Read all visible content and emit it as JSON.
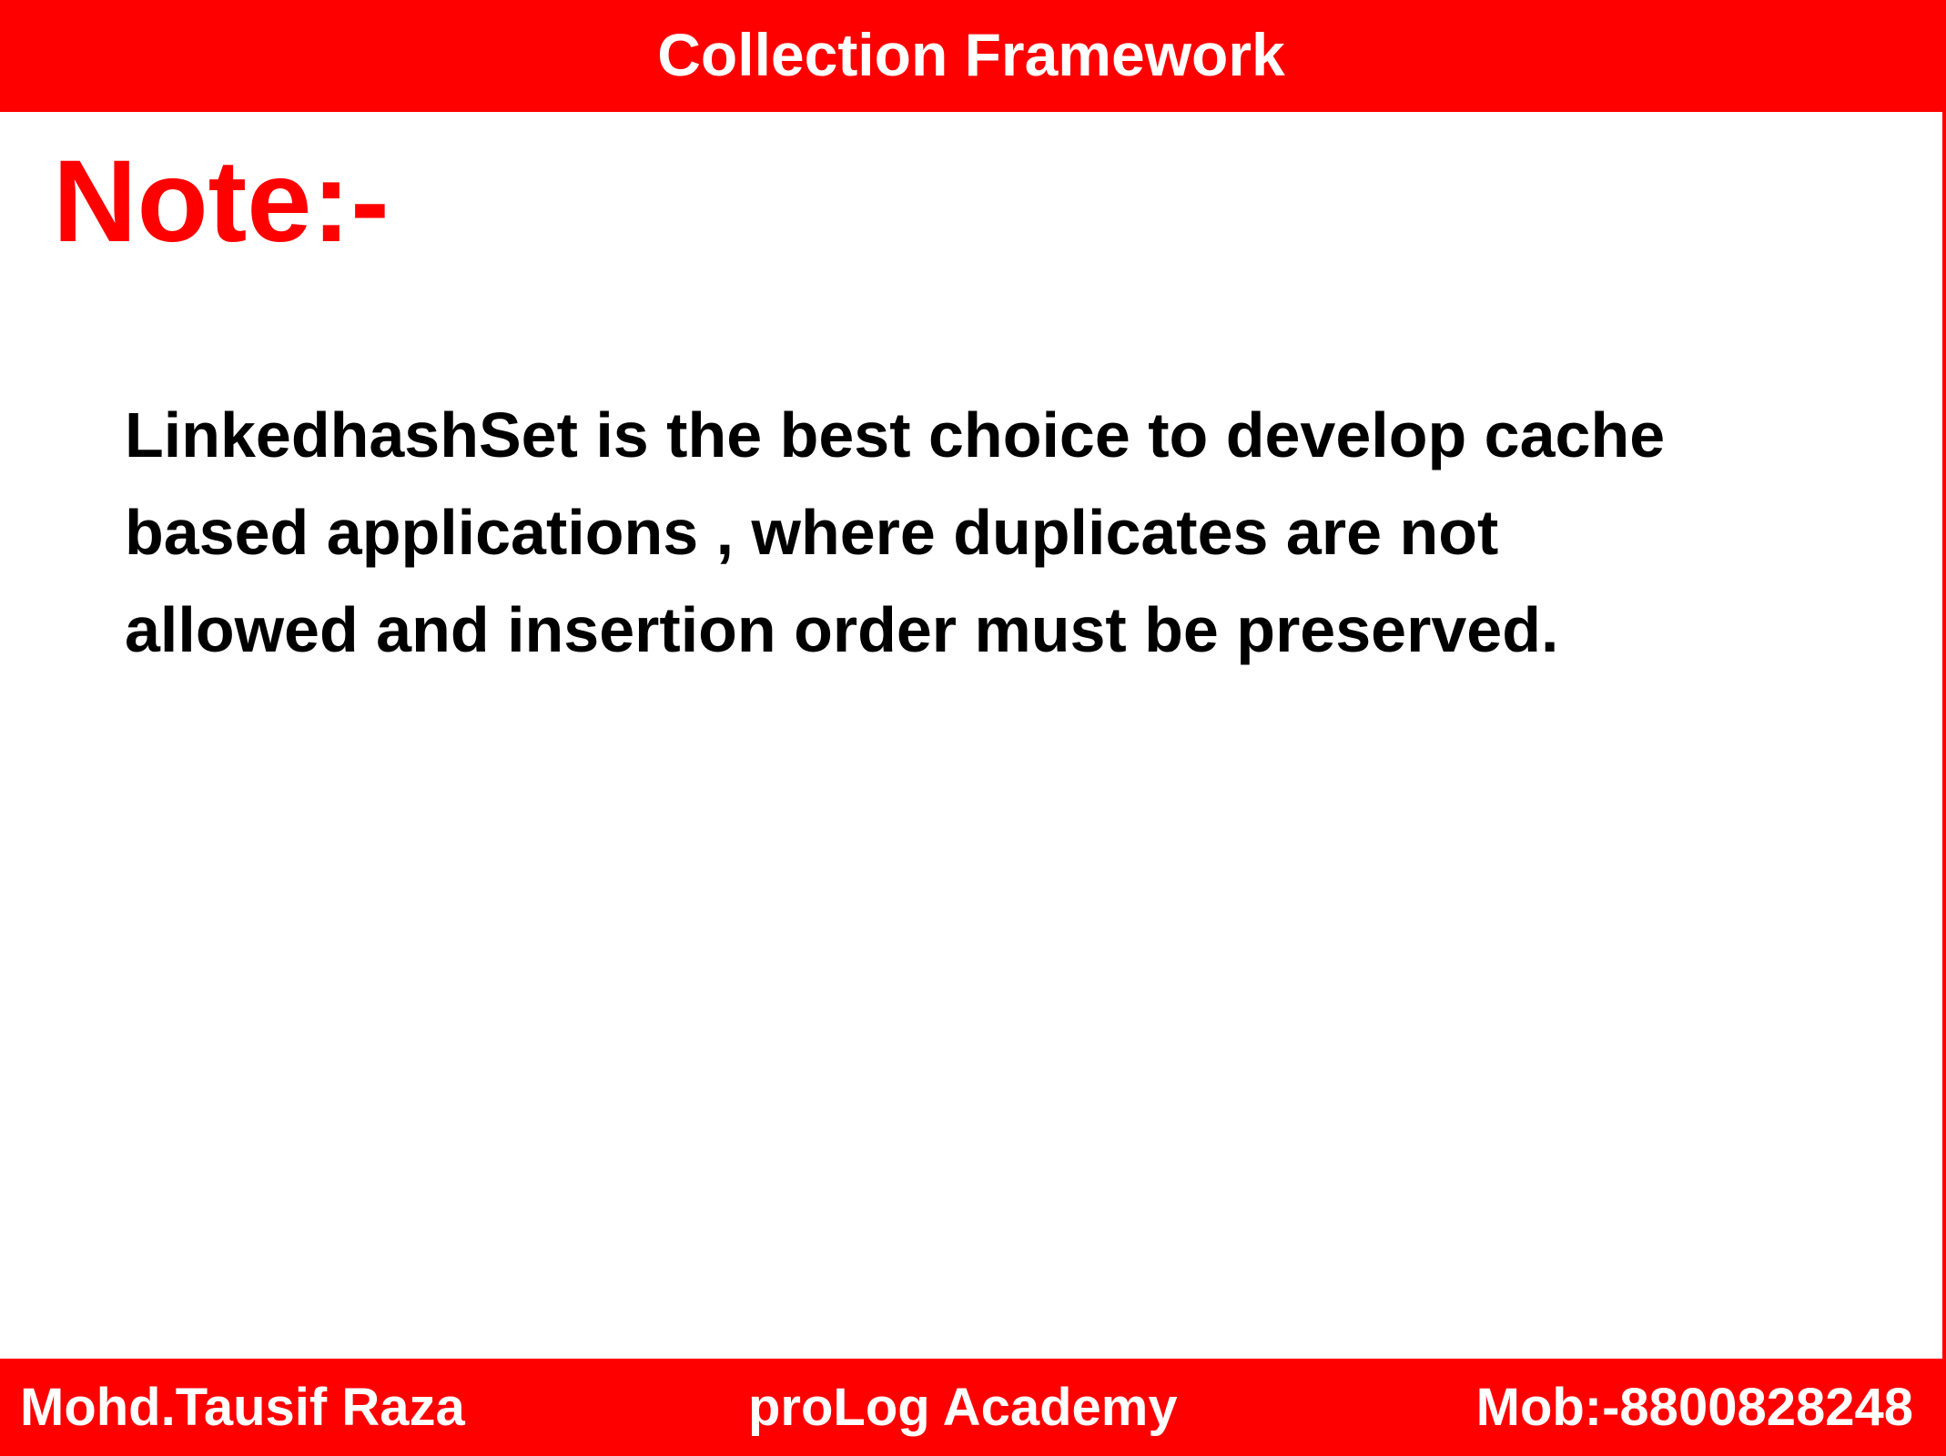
{
  "header": {
    "title": "Collection Framework"
  },
  "heading": "Note:-",
  "body": {
    "lines": [
      "LinkedhashSet is the best choice to develop cache",
      "based applications , where duplicates are not",
      "allowed and insertion order must be preserved."
    ]
  },
  "footer": {
    "author": "Mohd.Tausif Raza",
    "academy": "proLog Academy",
    "contact": "Mob:-8800828248"
  },
  "colors": {
    "accent": "#fe0000",
    "header_text": "#ffffff",
    "body_text": "#000000"
  }
}
